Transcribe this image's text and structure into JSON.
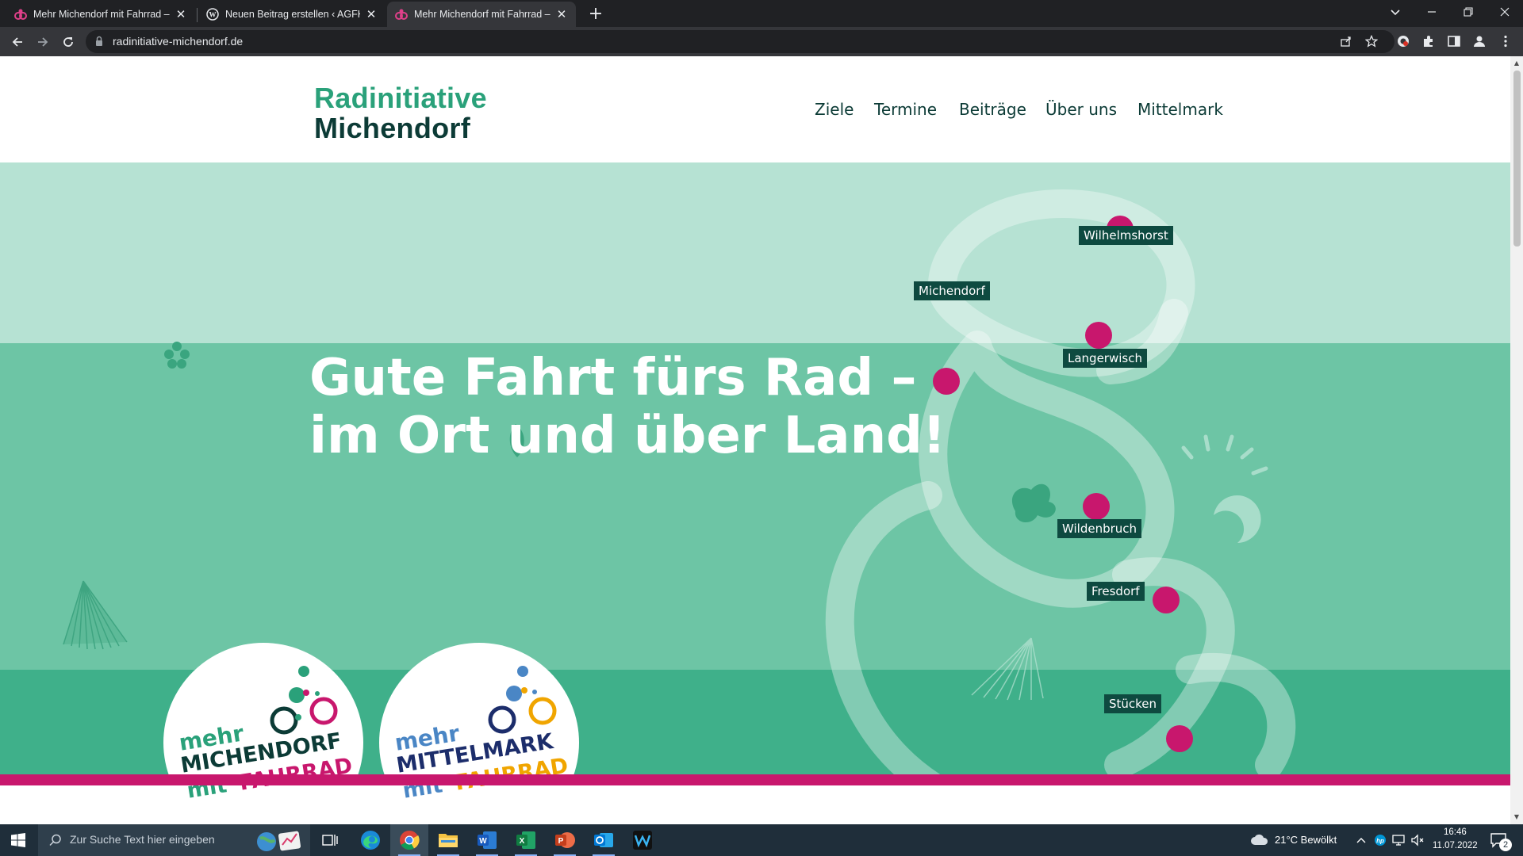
{
  "browser": {
    "tabs": [
      {
        "title": "Mehr Michendorf mit Fahrrad – R",
        "close": "✕"
      },
      {
        "title": "Neuen Beitrag erstellen ‹ AGFK –",
        "close": "✕"
      },
      {
        "title": "Mehr Michendorf mit Fahrrad – R",
        "close": "✕"
      }
    ],
    "new_tab": "+",
    "url": "radinitiative-michendorf.de"
  },
  "site": {
    "logo_line1": "Radinitiative",
    "logo_line2": "Michendorf",
    "nav": [
      "Ziele",
      "Termine",
      "Beiträge",
      "Über uns",
      "Mittelmark"
    ]
  },
  "hero": {
    "headline_line1": "Gute Fahrt fürs Rad –",
    "headline_line2": "im Ort und über Land!",
    "places": [
      "Wilhelmshorst",
      "Michendorf",
      "Langerwisch",
      "Wildenbruch",
      "Fresdorf",
      "Stücken"
    ],
    "badge1": {
      "line1": "mehr",
      "line2": "MICHENDORF",
      "line3a": "mit",
      "line3b": "FAHRRAD"
    },
    "badge2": {
      "line1": "mehr",
      "line2": "MITTELMARK",
      "line3a": "mit",
      "line3b": "FAHRRAD"
    }
  },
  "colors": {
    "brand_green": "#2aa17a",
    "brand_dark": "#0c3b36",
    "magenta": "#c8176d",
    "mint_light": "#b6e2d3",
    "mint_mid": "#6dc5a5",
    "mint_dark": "#3fb08a"
  },
  "taskbar": {
    "search_placeholder": "Zur Suche Text hier eingeben",
    "weather": "21°C  Bewölkt",
    "time": "16:46",
    "date": "11.07.2022",
    "notification_count": "2"
  }
}
